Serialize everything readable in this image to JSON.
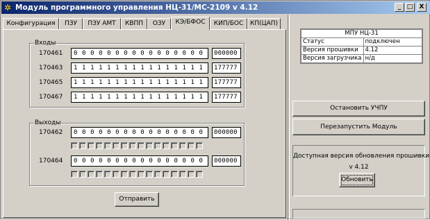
{
  "window": {
    "title": "Модуль программного управления НЦ-31/МС-2109 v 4.12",
    "minimize_label": "_",
    "maximize_label": "□",
    "close_label": "X"
  },
  "tabs": [
    {
      "label": "Конфигурация",
      "active": false
    },
    {
      "label": "ПЗУ",
      "active": false
    },
    {
      "label": "ПЗУ АМТ",
      "active": false
    },
    {
      "label": "КВПП",
      "active": false
    },
    {
      "label": "ОЗУ",
      "active": false
    },
    {
      "label": "КЭ/БФОС",
      "active": true
    },
    {
      "label": "КИП/БОС",
      "active": false
    },
    {
      "label": "КП(ЦАП)",
      "active": false
    }
  ],
  "inputs": {
    "title": "Входы",
    "rows": [
      {
        "address": "170461",
        "bits": "0 0 0 0 0 0 0 0 0 0 0 0 0 0 0 0",
        "octal": "000000"
      },
      {
        "address": "170463",
        "bits": "1 1 1 1 1 1 1 1 1 1 1 1 1 1 1 1",
        "octal": "177777"
      },
      {
        "address": "170465",
        "bits": "1 1 1 1 1 1 1 1 1 1 1 1 1 1 1 1",
        "octal": "177777"
      },
      {
        "address": "170467",
        "bits": "1 1 1 1 1 1 1 1 1 1 1 1 1 1 1 1",
        "octal": "177777"
      }
    ]
  },
  "outputs": {
    "title": "Выходы",
    "rows": [
      {
        "address": "170462",
        "bits": "0 0 0 0 0 0 0 0 0 0 0 0 0 0 0 0",
        "octal": "000000"
      },
      {
        "address": "170464",
        "bits": "0 0 0 0 0 0 0 0 0 0 0 0 0 0 0 0",
        "octal": "000000"
      }
    ]
  },
  "send_button": "Отправить",
  "status_table": {
    "header": "МПУ НЦ-31",
    "rows": [
      {
        "label": "Статус",
        "value": "подключен"
      },
      {
        "label": "Версия прошивки",
        "value": "4.12"
      },
      {
        "label": "Версия загрузчика",
        "value": "н/д"
      }
    ]
  },
  "stop_button": "Остановить УЧПУ",
  "restart_button": "Перезапустить Модуль",
  "update": {
    "text": "Доступная версия обновления прошивки:",
    "version": "v 4.12",
    "button": "Обновить"
  }
}
